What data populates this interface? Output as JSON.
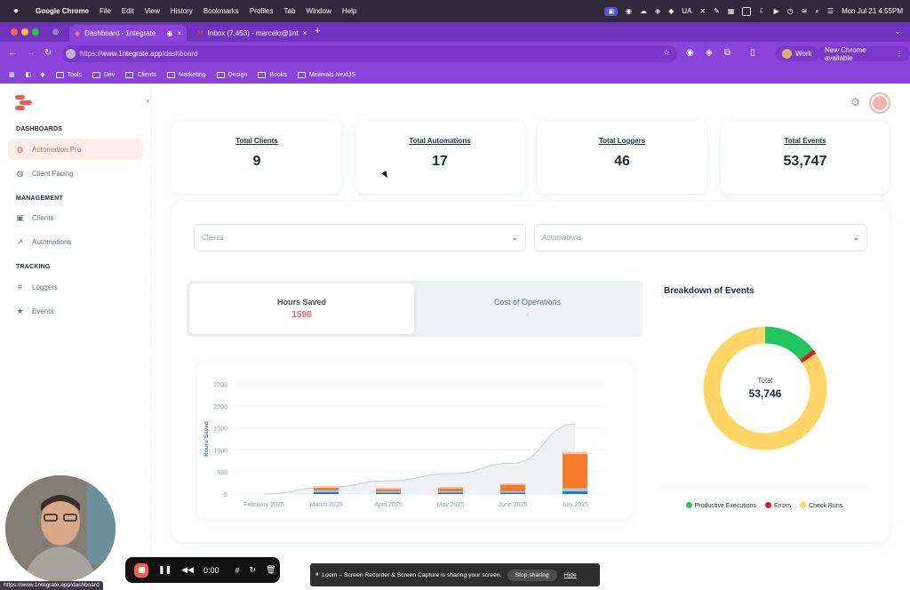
{
  "menubar": {
    "app_name": "Google Chrome",
    "menus": [
      "File",
      "Edit",
      "View",
      "History",
      "Bookmarks",
      "Profiles",
      "Tab",
      "Window",
      "Help"
    ],
    "status_ua": "UA",
    "datetime": "Mon Jul 21  4:55PM"
  },
  "browser": {
    "tabs": [
      {
        "title": "Dashboard - 1ntegrate"
      },
      {
        "title": "Inbox (7,453) - marcelo@1nt"
      }
    ],
    "url_prefix": "https://",
    "url_host": "www.1ntegrate.app",
    "url_path": "/dashboard",
    "profile": "Work",
    "update": "New Chrome available",
    "bookmarks": [
      "Tools",
      "Dev",
      "Clients",
      "Marketing",
      "Design",
      "Books",
      "Minimals NextJS"
    ]
  },
  "sidebar": {
    "sections": [
      {
        "title": "DASHBOARDS",
        "items": [
          "Automation Pro",
          "Client Facing"
        ]
      },
      {
        "title": "MANAGEMENT",
        "items": [
          "Clients",
          "Automations"
        ]
      },
      {
        "title": "TRACKING",
        "items": [
          "Loggers",
          "Events"
        ]
      }
    ]
  },
  "stats": [
    {
      "label": "Total Clients",
      "value": "9"
    },
    {
      "label": "Total Automations",
      "value": "17"
    },
    {
      "label": "Total Loggers",
      "value": "46"
    },
    {
      "label": "Total Events",
      "value": "53,747"
    }
  ],
  "filters": {
    "clients_placeholder": "Clients",
    "automations_placeholder": "Automations"
  },
  "toggle": {
    "hours_label": "Hours Saved",
    "hours_value": "1598",
    "cost_label": "Cost of Operations",
    "cost_value": "-"
  },
  "chart_data": [
    {
      "type": "bar",
      "ylabel": "Hours Saved",
      "ylim": [
        0,
        2500
      ],
      "yticks": [
        0,
        500,
        1000,
        1500,
        2000,
        2500
      ],
      "categories": [
        "February 2025",
        "March 2025",
        "April 2025",
        "May 2025",
        "June 2025",
        "July 2025"
      ],
      "series": [
        {
          "values": [
            0,
            40,
            30,
            30,
            30,
            60
          ],
          "color": "#1976d2"
        },
        {
          "values": [
            0,
            40,
            30,
            30,
            30,
            70
          ],
          "color": "#a7c7e8"
        },
        {
          "values": [
            0,
            60,
            50,
            70,
            150,
            780
          ],
          "color": "#f57c2b"
        },
        {
          "values": [
            0,
            40,
            30,
            30,
            30,
            50
          ],
          "color": "#f6c2c0"
        }
      ],
      "cumulative_line": [
        0,
        150,
        300,
        460,
        700,
        1590
      ]
    },
    {
      "type": "pie",
      "title": "Breakdown of Events",
      "center_label": "Total",
      "total": "53,746",
      "slices": [
        {
          "name": "Productive Executions",
          "value": 7600,
          "color": "#22c55e"
        },
        {
          "name": "Errors",
          "value": 700,
          "color": "#c62828"
        },
        {
          "name": "Check Runs",
          "value": 45446,
          "color": "#ffd666"
        }
      ]
    }
  ],
  "recorder": {
    "time": "0:00",
    "share_text": "Loom – Screen Recorder & Screen Capture is sharing your screen.",
    "stop_label": "Stop sharing",
    "hide_label": "Hide"
  },
  "status_url": "https://www.1ntegrate.app/dashboard"
}
